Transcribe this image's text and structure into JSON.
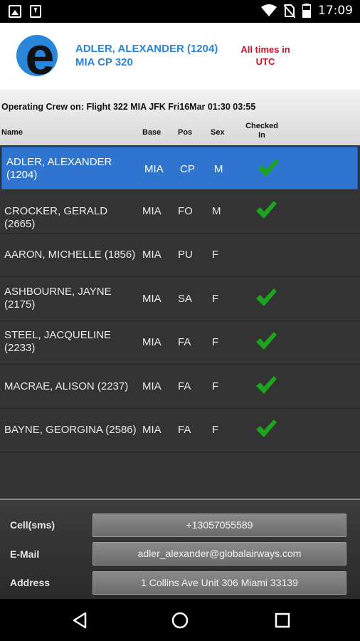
{
  "status_bar": {
    "time": "17:09",
    "icons": [
      "gallery-icon",
      "download-icon",
      "wifi-icon",
      "no-sim-icon",
      "battery-icon"
    ]
  },
  "header": {
    "logo_letter": "e",
    "crew_member": "ADLER, ALEXANDER (1204)",
    "assignment": "MIA CP 320",
    "times_note_line1": "All times in",
    "times_note_line2": "UTC"
  },
  "crew": {
    "title": "Operating Crew on: Flight 322 MIA JFK Fri16Mar 01:30 03:55",
    "columns": {
      "name": "Name",
      "base": "Base",
      "pos": "Pos",
      "sex": "Sex",
      "checked_in_line1": "Checked",
      "checked_in_line2": "In"
    },
    "rows": [
      {
        "name_line1": "ADLER, ALEXANDER",
        "name_line2": "(1204)",
        "base": "MIA",
        "pos": "CP",
        "sex": "M",
        "checked_in": true,
        "selected": true
      },
      {
        "name_line1": "CROCKER, GERALD (2665)",
        "name_line2": "",
        "base": "MIA",
        "pos": "FO",
        "sex": "M",
        "checked_in": true,
        "selected": false
      },
      {
        "name_line1": "AARON, MICHELLE (1856)",
        "name_line2": "",
        "base": "MIA",
        "pos": "PU",
        "sex": "F",
        "checked_in": false,
        "selected": false
      },
      {
        "name_line1": "ASHBOURNE, JAYNE",
        "name_line2": "(2175)",
        "base": "MIA",
        "pos": "SA",
        "sex": "F",
        "checked_in": true,
        "selected": false
      },
      {
        "name_line1": "STEEL, JACQUELINE",
        "name_line2": "(2233)",
        "base": "MIA",
        "pos": "FA",
        "sex": "F",
        "checked_in": true,
        "selected": false
      },
      {
        "name_line1": "MACRAE, ALISON (2237)",
        "name_line2": "",
        "base": "MIA",
        "pos": "FA",
        "sex": "F",
        "checked_in": true,
        "selected": false
      },
      {
        "name_line1": "BAYNE, GEORGINA (2586)",
        "name_line2": "",
        "base": "MIA",
        "pos": "FA",
        "sex": "F",
        "checked_in": true,
        "selected": false
      }
    ]
  },
  "contact": {
    "cell_label": "Cell(sms)",
    "cell_value": "+13057055589",
    "email_label": "E-Mail",
    "email_value": "adler_alexander@globalairways.com",
    "address_label": "Address",
    "address_value": "1 Collins Ave Unit 306   Miami 33139"
  },
  "colors": {
    "accent_blue": "#2a86d8",
    "selected_row": "#2f74cf",
    "utc_red": "#d0112b",
    "check_green": "#1ea31e"
  }
}
